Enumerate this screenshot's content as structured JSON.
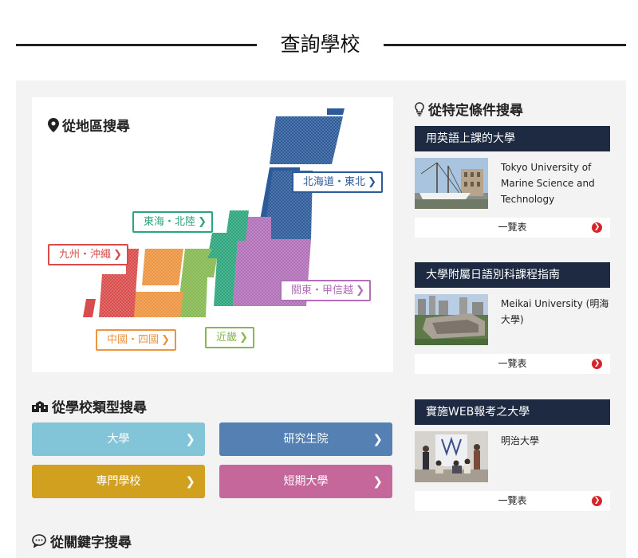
{
  "page_title": "查詢學校",
  "map_section": {
    "heading": "從地區搜尋",
    "regions": [
      {
        "label": "北海道・東北",
        "color": "#2d5b9a"
      },
      {
        "label": "東海・北陸",
        "color": "#2ca57c"
      },
      {
        "label": "九州・沖繩",
        "color": "#d94c4c"
      },
      {
        "label": "關東・甲信越",
        "color": "#b06fb7"
      },
      {
        "label": "中國・四國",
        "color": "#ec9440"
      },
      {
        "label": "近畿",
        "color": "#86b851"
      }
    ]
  },
  "type_section": {
    "heading": "從學校類型搜尋",
    "buttons": [
      {
        "label": "大學",
        "color": "#82c4d8"
      },
      {
        "label": "研究生院",
        "color": "#5480b3"
      },
      {
        "label": "專門學校",
        "color": "#d2a01f"
      },
      {
        "label": "短期大學",
        "color": "#c5679b"
      }
    ]
  },
  "keyword_section": {
    "heading": "從關鍵字搜尋"
  },
  "conditions": {
    "heading": "從特定條件搜尋",
    "cards": [
      {
        "header": "用英語上課的大學",
        "text": "Tokyo University of Marine Science and Technology",
        "list_label": "一覽表"
      },
      {
        "header": "大學附屬日語別科課程指南",
        "text": "Meikai University (明海大學)",
        "list_label": "一覽表"
      },
      {
        "header": "實施WEB報考之大學",
        "text": "明治大學",
        "list_label": "一覽表"
      }
    ]
  }
}
